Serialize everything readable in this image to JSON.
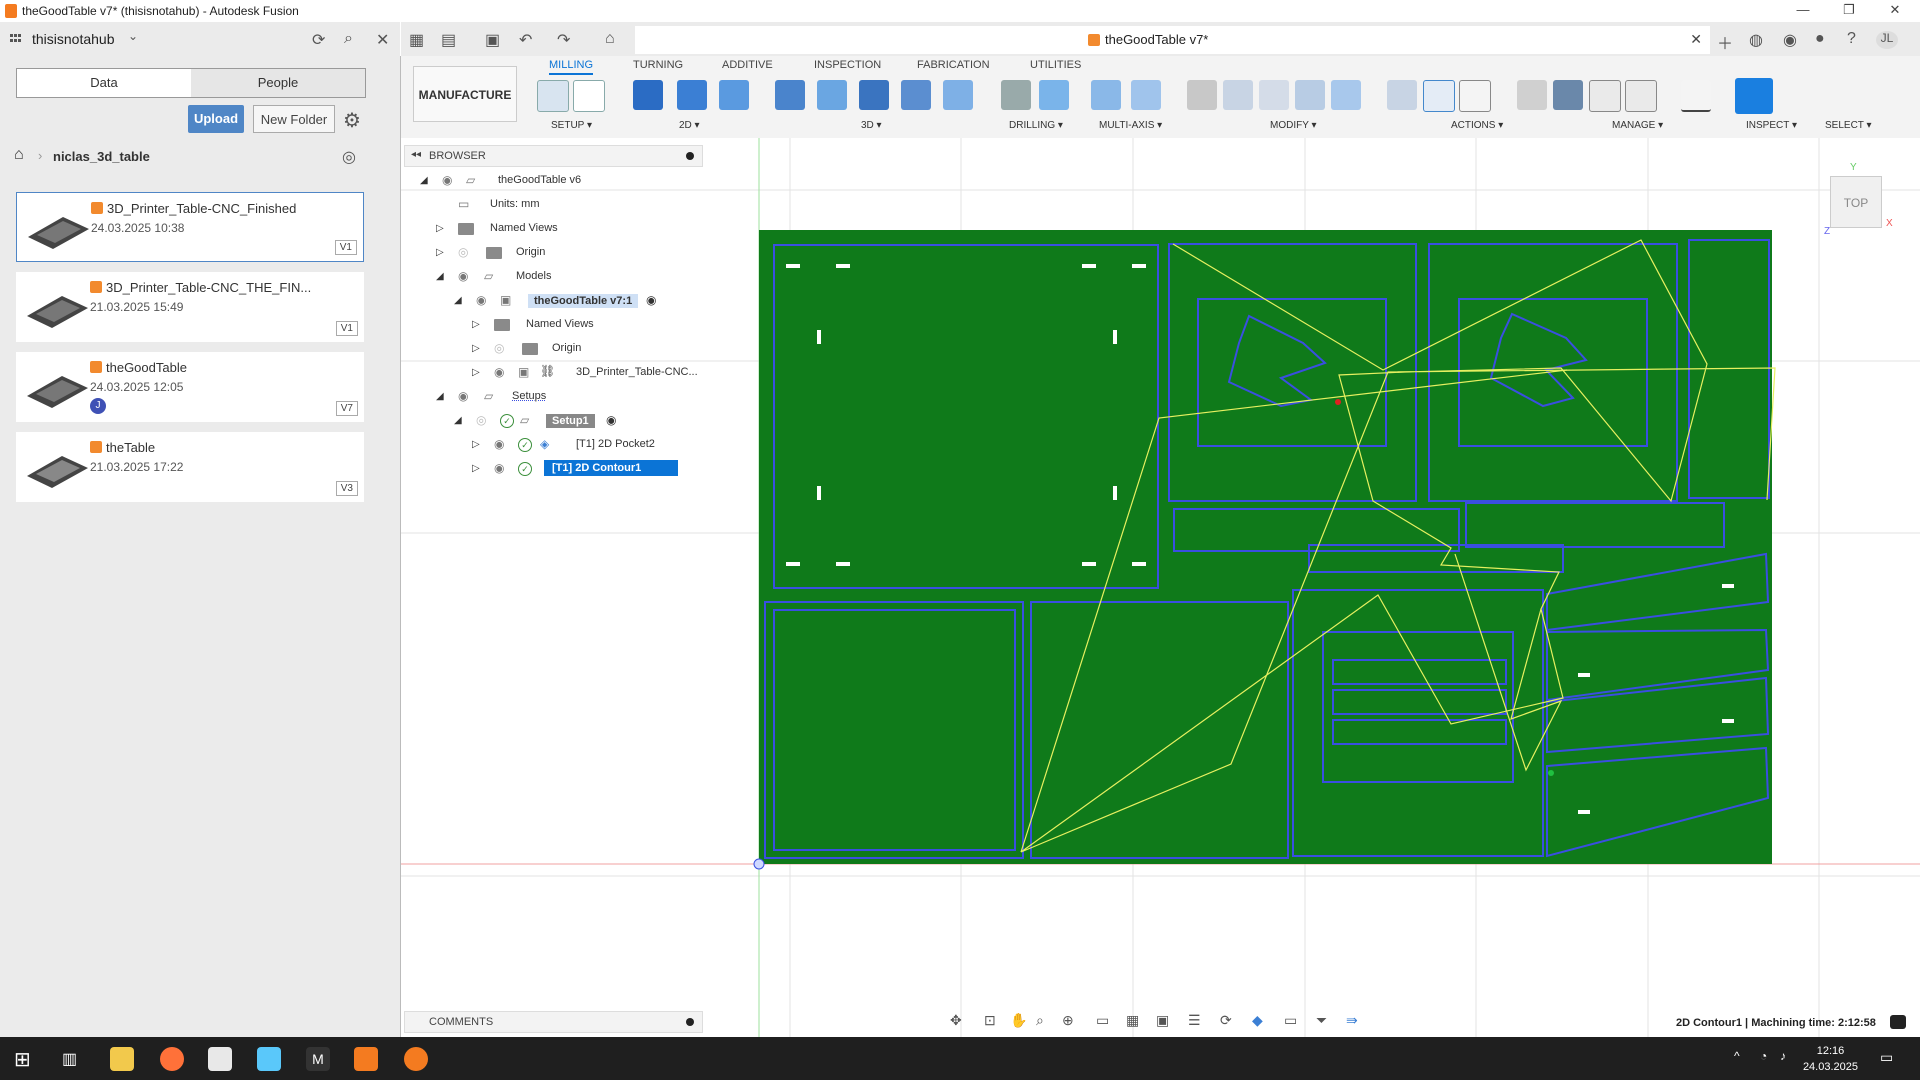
{
  "window": {
    "title": "theGoodTable v7* (thisisnotahub) - Autodesk Fusion",
    "controls": [
      "—",
      "❐",
      "✕"
    ]
  },
  "hub": {
    "name": "thisisnotahub"
  },
  "data_panel": {
    "tabs": [
      "Data",
      "People"
    ],
    "upload_label": "Upload",
    "new_folder_label": "New Folder",
    "breadcrumb": "niclas_3d_table",
    "files": [
      {
        "name": "3D_Printer_Table-CNC_Finished",
        "date": "24.03.2025 10:38",
        "version": "V1"
      },
      {
        "name": "3D_Printer_Table-CNC_THE_FIN...",
        "date": "21.03.2025 15:49",
        "version": "V1"
      },
      {
        "name": "theGoodTable",
        "date": "24.03.2025 12:05",
        "version": "V7",
        "user": "J"
      },
      {
        "name": "theTable",
        "date": "21.03.2025 17:22",
        "version": "V3"
      }
    ]
  },
  "document": {
    "tab_title": "theGoodTable v7*",
    "user_initials": "JL"
  },
  "toolbar": {
    "workspace": "MANUFACTURE ▾",
    "tabs": [
      "MILLING",
      "TURNING",
      "ADDITIVE",
      "INSPECTION",
      "FABRICATION",
      "UTILITIES"
    ],
    "active_tab": "MILLING",
    "groups": [
      "SETUP ▾",
      "2D ▾",
      "3D ▾",
      "DRILLING ▾",
      "MULTI-AXIS ▾",
      "MODIFY ▾",
      "ACTIONS ▾",
      "MANAGE ▾",
      "INSPECT ▾",
      "SELECT ▾"
    ]
  },
  "browser": {
    "header": "BROWSER",
    "items": [
      {
        "label": "theGoodTable v6"
      },
      {
        "label": "Units: mm"
      },
      {
        "label": "Named Views"
      },
      {
        "label": "Origin"
      },
      {
        "label": "Models"
      },
      {
        "label": "theGoodTable v7:1"
      },
      {
        "label": "Named Views"
      },
      {
        "label": "Origin"
      },
      {
        "label": "3D_Printer_Table-CNC..."
      },
      {
        "label": "Setups"
      },
      {
        "label": "Setup1"
      },
      {
        "label": "[T1] 2D Pocket2"
      },
      {
        "label": "[T1] 2D Contour1"
      }
    ]
  },
  "comments": {
    "header": "COMMENTS"
  },
  "status": {
    "text": "2D Contour1 | Machining time: 2:12:58"
  },
  "viewcube": {
    "face": "TOP",
    "axes": [
      "Y",
      "X",
      "Z"
    ]
  },
  "taskbar": {
    "time": "12:16",
    "date": "24.03.2025"
  },
  "colors": {
    "stock": "#0f7a1a",
    "toolpath": "#3a4fe0",
    "rapid": "#e6f060",
    "accent": "#0b74d6"
  }
}
